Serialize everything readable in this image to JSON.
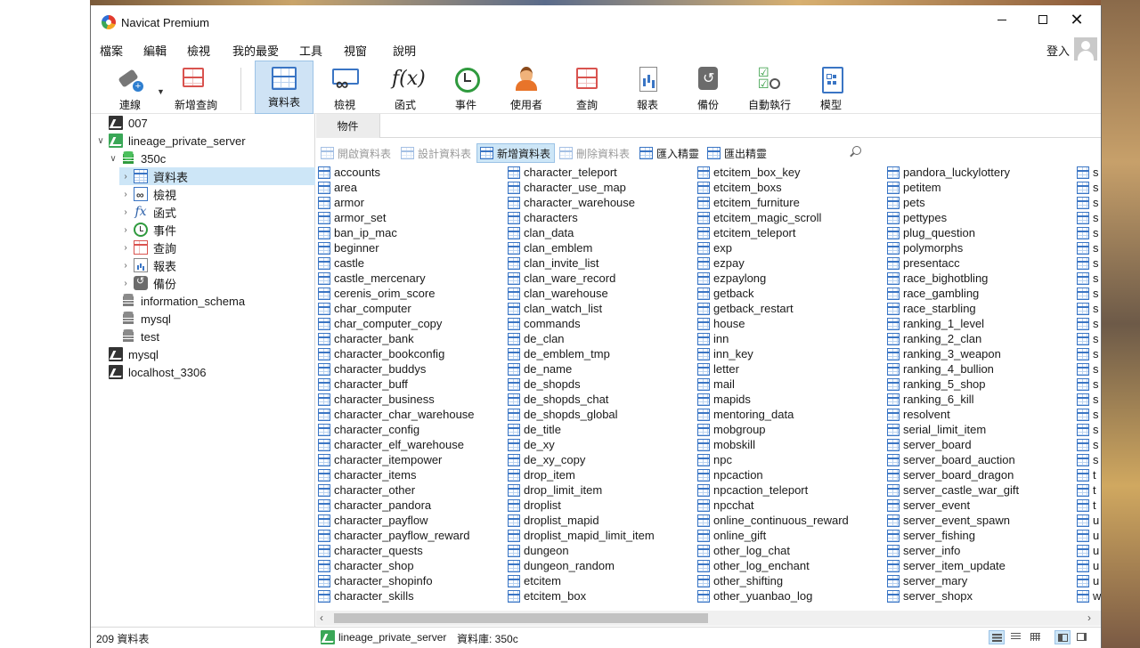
{
  "window": {
    "title": "Navicat Premium"
  },
  "menu": [
    "檔案",
    "編輯",
    "檢視",
    "我的最愛",
    "工具",
    "視窗",
    "說明"
  ],
  "login_label": "登入",
  "toolbar": {
    "connect": "連線",
    "new_query": "新增查詢",
    "table": "資料表",
    "view": "檢視",
    "function": "函式",
    "event": "事件",
    "user": "使用者",
    "query": "查詢",
    "report": "報表",
    "backup": "備份",
    "automation": "自動執行",
    "model": "模型",
    "function_icon_text": "f(x)"
  },
  "tree": {
    "conn_007": "007",
    "conn_lineage": "lineage_private_server",
    "db_350c": "350c",
    "node_tables": "資料表",
    "node_views": "檢視",
    "node_functions": "函式",
    "node_events": "事件",
    "node_queries": "查詢",
    "node_reports": "報表",
    "node_backups": "備份",
    "db_info_schema": "information_schema",
    "db_mysql": "mysql",
    "db_test": "test",
    "conn_mysql": "mysql",
    "conn_localhost": "localhost_3306",
    "fx_icon_text": "fx"
  },
  "tabs": {
    "objects": "物件"
  },
  "object_toolbar": {
    "open_table": "開啟資料表",
    "design_table": "設計資料表",
    "new_table": "新增資料表",
    "delete_table": "刪除資料表",
    "import_wizard": "匯入精靈",
    "export_wizard": "匯出精靈"
  },
  "tables": {
    "col1": [
      "accounts",
      "area",
      "armor",
      "armor_set",
      "ban_ip_mac",
      "beginner",
      "castle",
      "castle_mercenary",
      "cerenis_orim_score",
      "char_computer",
      "char_computer_copy",
      "character_bank",
      "character_bookconfig",
      "character_buddys",
      "character_buff",
      "character_business",
      "character_char_warehouse",
      "character_config",
      "character_elf_warehouse",
      "character_itempower",
      "character_items",
      "character_other",
      "character_pandora",
      "character_payflow",
      "character_payflow_reward",
      "character_quests",
      "character_shop",
      "character_shopinfo",
      "character_skills"
    ],
    "col2": [
      "character_teleport",
      "character_use_map",
      "character_warehouse",
      "characters",
      "clan_data",
      "clan_emblem",
      "clan_invite_list",
      "clan_ware_record",
      "clan_warehouse",
      "clan_watch_list",
      "commands",
      "de_clan",
      "de_emblem_tmp",
      "de_name",
      "de_shopds",
      "de_shopds_chat",
      "de_shopds_global",
      "de_title",
      "de_xy",
      "de_xy_copy",
      "drop_item",
      "drop_limit_item",
      "droplist",
      "droplist_mapid",
      "droplist_mapid_limit_item",
      "dungeon",
      "dungeon_random",
      "etcitem",
      "etcitem_box"
    ],
    "col3": [
      "etcitem_box_key",
      "etcitem_boxs",
      "etcitem_furniture",
      "etcitem_magic_scroll",
      "etcitem_teleport",
      "exp",
      "ezpay",
      "ezpaylong",
      "getback",
      "getback_restart",
      "house",
      "inn",
      "inn_key",
      "letter",
      "mail",
      "mapids",
      "mentoring_data",
      "mobgroup",
      "mobskill",
      "npc",
      "npcaction",
      "npcaction_teleport",
      "npcchat",
      "online_continuous_reward",
      "online_gift",
      "other_log_chat",
      "other_log_enchant",
      "other_shifting",
      "other_yuanbao_log"
    ],
    "col4": [
      "pandora_luckylottery",
      "petitem",
      "pets",
      "pettypes",
      "plug_question",
      "polymorphs",
      "presentacc",
      "race_bighotbling",
      "race_gambling",
      "race_starbling",
      "ranking_1_level",
      "ranking_2_clan",
      "ranking_3_weapon",
      "ranking_4_bullion",
      "ranking_5_shop",
      "ranking_6_kill",
      "resolvent",
      "serial_limit_item",
      "server_board",
      "server_board_auction",
      "server_board_dragon",
      "server_castle_war_gift",
      "server_event",
      "server_event_spawn",
      "server_fishing",
      "server_info",
      "server_item_update",
      "server_mary",
      "server_shopx"
    ],
    "col5": [
      "s",
      "s",
      "s",
      "s",
      "s",
      "s",
      "s",
      "s",
      "s",
      "s",
      "s",
      "s",
      "s",
      "s",
      "s",
      "s",
      "s",
      "s",
      "s",
      "s",
      "t",
      "t",
      "t",
      "u",
      "u",
      "u",
      "u",
      "u",
      "w"
    ]
  },
  "status": {
    "count": "209 資料表",
    "connection": "lineage_private_server",
    "database": "資料庫: 350c"
  }
}
